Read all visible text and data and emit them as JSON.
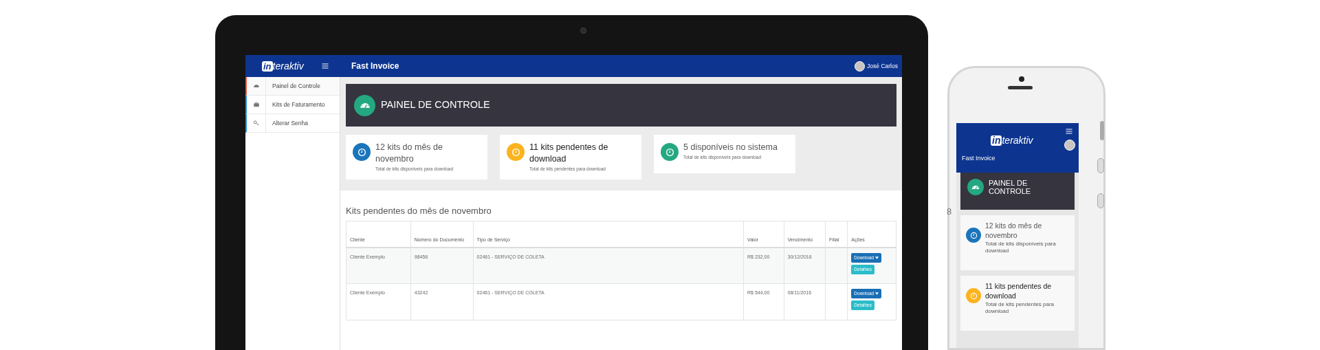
{
  "laptop": {
    "brand": {
      "mark": "in",
      "rest": "teraktiv"
    },
    "app_title": "Fast Invoice",
    "user_name": "José Carlos",
    "sidebar": {
      "items": [
        {
          "label": "Painel de Controle",
          "selected": true
        },
        {
          "label": "Kits de Faturamento",
          "selected": false
        },
        {
          "label": "Alterar Senha",
          "selected": false
        }
      ]
    },
    "banner": {
      "title": "PAINEL DE CONTROLE"
    },
    "stats": [
      {
        "title": "12 kits do mês de novembro",
        "subtitle": "Total de kits disponíveis para download",
        "color": "#1b75bb"
      },
      {
        "title": "11 kits pendentes de download",
        "subtitle": "Total de kits pendentes para download",
        "color": "#fbb31e"
      },
      {
        "title": "5 disponíveis no sistema",
        "subtitle": "Total de kits disponíveis para download",
        "color": "#24a882"
      }
    ],
    "table": {
      "title": "Kits pendentes do mês de novembro",
      "columns": [
        "Cliente",
        "Número do Documento",
        "Tipo de Serviço",
        "Valor",
        "Vencimento",
        "Filial",
        "Ações"
      ],
      "rows": [
        {
          "cells": [
            "Cliente Exemplo",
            "98456",
            "02461 - SERVIÇO DE COLETA",
            "R$ 232,00",
            "30/12/2016",
            ""
          ],
          "actions": [
            "Download",
            "Detalhes"
          ]
        },
        {
          "cells": [
            "Cliente Exemplo",
            "43242",
            "02461 - SERVIÇO DE COLETA",
            "R$ 544,00",
            "08/11/2016",
            ""
          ],
          "actions": [
            "Download",
            "Detalhes"
          ]
        }
      ]
    }
  },
  "stray_text": "8",
  "phone": {
    "brand": {
      "mark": "in",
      "rest": "teraktiv"
    },
    "app_title": "Fast Invoice",
    "banner": {
      "title": "PAINEL DE CONTROLE"
    },
    "stats": [
      {
        "title": "12 kits do mês de novembro",
        "subtitle": "Total de kits disponíveis para download",
        "color": "#1b75bb"
      },
      {
        "title": "11 kits pendentes de download",
        "subtitle": "Total de kits pendentes para download",
        "color": "#fbb31e"
      }
    ]
  }
}
